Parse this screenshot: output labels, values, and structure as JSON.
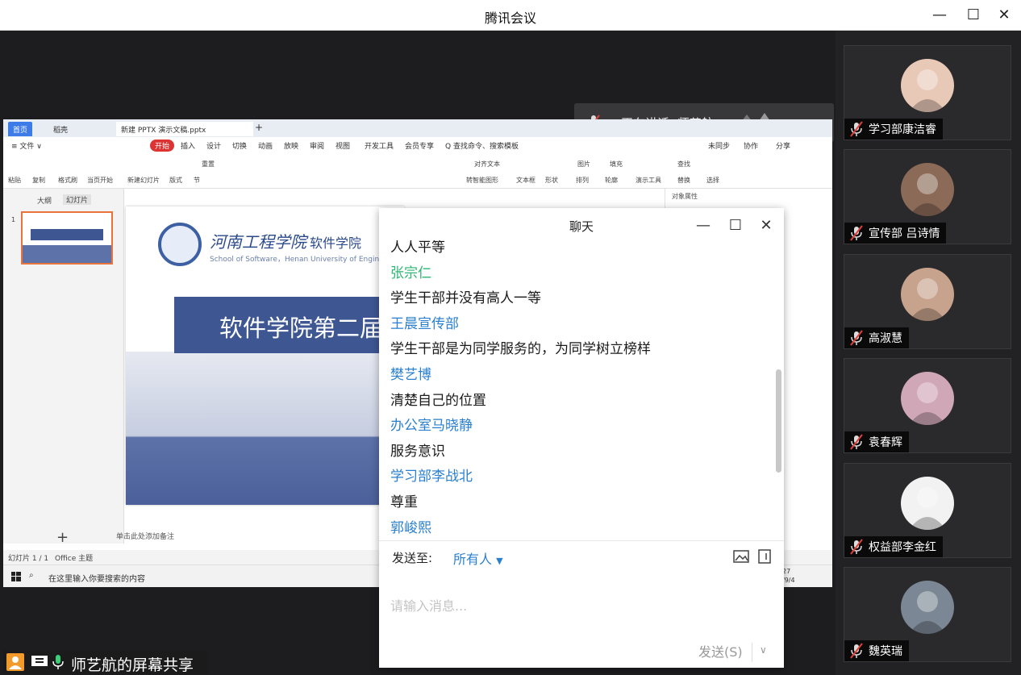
{
  "window": {
    "title": "腾讯会议",
    "minimize": "—",
    "maximize": "☐",
    "close": "✕"
  },
  "speaking": {
    "text": "正在讲话: 师艺航;"
  },
  "shared_screen": {
    "tabs": [
      "首页",
      "稻壳",
      "新建 PPTX 演示文稿.pptx"
    ],
    "menu": [
      "≡ 文件 ∨",
      "开始",
      "插入",
      "设计",
      "切换",
      "动画",
      "放映",
      "审阅",
      "视图",
      "开发工具",
      "会员专享",
      "Q 查找命令、搜索模板"
    ],
    "menu_right": [
      "未同步",
      "协作",
      "分享"
    ],
    "ribbon": [
      "粘贴",
      "复制",
      "格式刷",
      "当页开始",
      "新建幻灯片",
      "版式",
      "节",
      "重置",
      "文本框",
      "形状",
      "排列",
      "轮廓",
      "演示工具",
      "替换",
      "选择",
      "查找",
      "图片",
      "填充",
      "对齐文本",
      "转智能图形"
    ],
    "left_pane_tabs": [
      "大纲",
      "幻灯片"
    ],
    "slide_number": "1",
    "slide": {
      "university": "河南工程学院",
      "school": "软件学院",
      "subtitle": "School of Software，Henan University of Engineering",
      "banner": "软件学院第二届"
    },
    "notes_placeholder": "单击此处添加备注",
    "status": {
      "slide_info": "幻灯片 1 / 1",
      "theme": "Office 主题"
    },
    "taskbar": {
      "search": "在这里输入你要搜索的内容",
      "time": "27",
      "date": "/9/4"
    },
    "right_panel": {
      "title": "对象属性"
    }
  },
  "chat": {
    "title": "聊天",
    "messages": [
      {
        "kind": "text",
        "value": "人人平等"
      },
      {
        "kind": "name-green",
        "value": "张宗仁"
      },
      {
        "kind": "text",
        "value": "学生干部并没有高人一等"
      },
      {
        "kind": "name",
        "value": "王晨宣传部"
      },
      {
        "kind": "text",
        "value": "学生干部是为同学服务的，为同学树立榜样"
      },
      {
        "kind": "name",
        "value": "樊艺博"
      },
      {
        "kind": "text",
        "value": "清楚自己的位置"
      },
      {
        "kind": "name",
        "value": "办公室马晓静"
      },
      {
        "kind": "text",
        "value": "服务意识"
      },
      {
        "kind": "name",
        "value": "学习部李战北"
      },
      {
        "kind": "text",
        "value": "尊重"
      },
      {
        "kind": "name",
        "value": "郭峻熙"
      }
    ],
    "send_to_label": "发送至:",
    "send_to_value": "所有人",
    "input_placeholder": "请输入消息...",
    "send_button": "发送(S)"
  },
  "share_label": {
    "text": "师艺航的屏幕共享"
  },
  "participants": [
    {
      "name": "学习部康洁睿",
      "avatar_color": "#e8c9b8"
    },
    {
      "name": "宣传部 吕诗情",
      "avatar_color": "#8b6a58"
    },
    {
      "name": "高淑慧",
      "avatar_color": "#c7a28c"
    },
    {
      "name": "袁春辉",
      "avatar_color": "#cfa7b7"
    },
    {
      "name": "权益部李金红",
      "avatar_color": "#f2f2f2"
    },
    {
      "name": "魏英瑞",
      "avatar_color": "#7b8794"
    }
  ],
  "colors": {
    "accent_blue": "#2a7fcf",
    "name_green": "#2fb574",
    "slide_banner": "#3e5793",
    "share_icon": "#f29b2b"
  }
}
